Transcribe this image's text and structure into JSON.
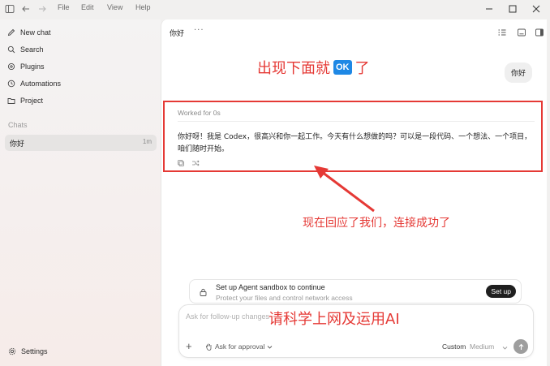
{
  "menu": {
    "file": "File",
    "edit": "Edit",
    "view": "View",
    "help": "Help"
  },
  "sidebar": {
    "items": [
      {
        "label": "New chat",
        "icon": "edit-icon"
      },
      {
        "label": "Search",
        "icon": "search-icon"
      },
      {
        "label": "Plugins",
        "icon": "plugins-icon"
      },
      {
        "label": "Automations",
        "icon": "clock-icon"
      },
      {
        "label": "Project",
        "icon": "folder-icon"
      }
    ],
    "chats_label": "Chats",
    "chats": [
      {
        "title": "你好",
        "time": "1m"
      }
    ],
    "settings_label": "Settings"
  },
  "header": {
    "title": "你好",
    "more": "···"
  },
  "annotations": {
    "top_prefix": "出现下面就",
    "ok_badge": "OK",
    "top_suffix": "了",
    "arrow_text": "现在回应了我们，连接成功了",
    "composer_text": "请科学上网及运用AI"
  },
  "conversation": {
    "user_message": "你好",
    "worked_label": "Worked for 0s",
    "reply": "你好呀！我是 Codex，很高兴和你一起工作。今天有什么想做的吗？可以是一段代码、一个想法、一个项目，咱们随时开始。"
  },
  "sandbox": {
    "title": "Set up Agent sandbox to continue",
    "subtitle": "Protect your files and control network access",
    "button": "Set up"
  },
  "composer": {
    "placeholder": "Ask for follow-up changes",
    "approval": "Ask for approval",
    "mode": "Custom",
    "reasoning": "Medium"
  },
  "colors": {
    "annotation_red": "#e53935",
    "ok_blue": "#1e88e5"
  }
}
